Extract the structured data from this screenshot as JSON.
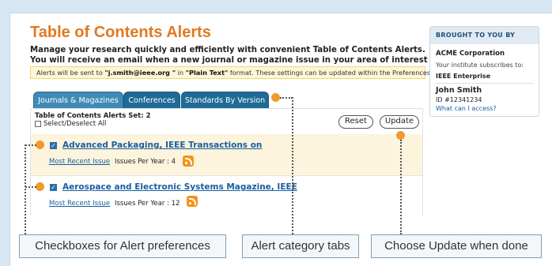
{
  "page": {
    "title": "Table of Contents Alerts",
    "intro": "Manage your research quickly and efficiently with convenient Table of Contents Alerts. You will receive an email when a new journal or magazine issue in your area of interest has been posted online",
    "notice_prefix": "Alerts will be sent to ",
    "notice_email": "\"j.smith@ieee.org \"",
    "notice_mid": " in ",
    "notice_format": "\"Plain Text\"",
    "notice_suffix": " format. These settings can be updated within the Preferences feature."
  },
  "tabs": [
    {
      "label": "Journals & Magazines",
      "active": true
    },
    {
      "label": "Conferences",
      "active": false
    },
    {
      "label": "Standards By Version",
      "active": false
    }
  ],
  "alerts_panel": {
    "set_title": "Table of Contents Alerts Set: 2",
    "select_all_label": "Select/Deselect All",
    "reset_label": "Reset",
    "update_label": "Update"
  },
  "alerts": [
    {
      "title": "Advanced Packaging, IEEE Transactions on",
      "recent_label": "Most Recent Issue",
      "issues_per_year": "Issues Per Year : 4",
      "checked": true
    },
    {
      "title": "Aerospace and Electronic Systems Magazine, IEEE",
      "recent_label": "Most Recent Issue",
      "issues_per_year": "Issues Per Year : 12",
      "checked": true
    }
  ],
  "sidebar": {
    "heading": "BROUGHT TO YOU BY",
    "org": "ACME Corporation",
    "subscribes": "Your institute subscribes to:",
    "subscription": "IEEE Enterprise",
    "user_name": "John Smith",
    "user_id": "ID #12341234",
    "access_link": "What can I access?"
  },
  "callouts": {
    "checkboxes": "Checkboxes for Alert preferences",
    "tabs": "Alert category tabs",
    "update": "Choose Update when done"
  },
  "colors": {
    "accent_orange": "#e07a1f",
    "tab_blue": "#1f6a96",
    "link_blue": "#1a5ea0",
    "notice_bg": "#fff6d5"
  },
  "icons": {
    "rss": "rss-feed-icon",
    "checkbox": "checkbox-checked-icon"
  }
}
